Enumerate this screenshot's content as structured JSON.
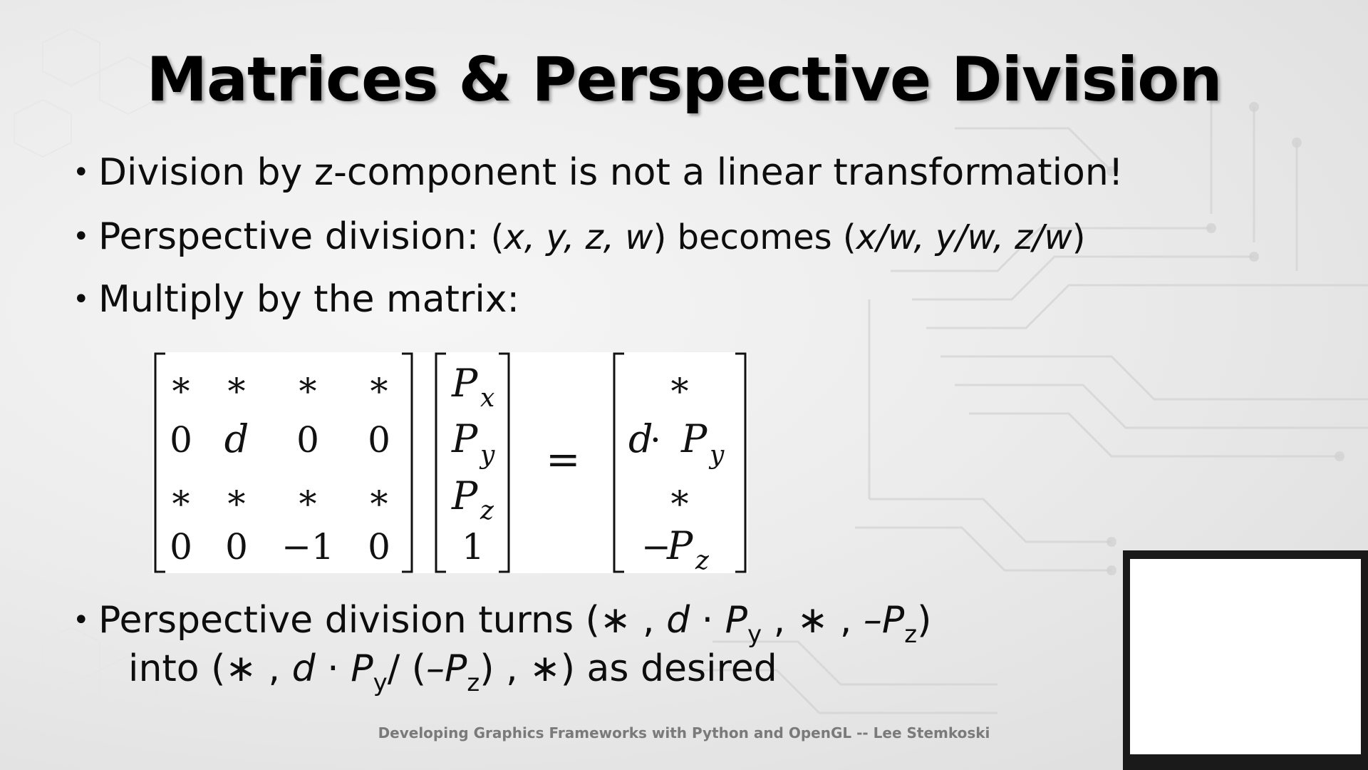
{
  "slide": {
    "title": "Matrices & Perspective Division",
    "bullets": {
      "b1": "Division by z-component is not a linear transformation!",
      "b2_prefix": "Perspective division: ",
      "b2_open": "(",
      "b2_vec": "x, y, z, w",
      "b2_mid": ") becomes (",
      "b2_res": "x/w, y/w, z/w",
      "b2_close": ")",
      "b3": "Multiply by the matrix:",
      "b4_prefix": "Perspective division turns (",
      "b4_star1": "∗ ,  ",
      "b4_d": "d",
      "b4_dot": " · ",
      "b4_P": "P",
      "b4_sub_y": "y",
      "b4_mid": " , ∗ , ",
      "b4_negP": "–P",
      "b4_sub_z": "z",
      "b4_close": ")",
      "b5_prefix": "into (∗ , ",
      "b5_d": "d",
      "b5_dot": " · ",
      "b5_P": "P",
      "b5_sub_y": "y",
      "b5_div": "/ (",
      "b5_negP": "–P",
      "b5_sub_z": "z",
      "b5_suffix": ") , ∗) as desired"
    },
    "bullet_glyph": "•",
    "matrix": {
      "rows": [
        [
          "∗",
          "∗",
          "∗",
          "∗"
        ],
        [
          "0",
          "d",
          "0",
          "0"
        ],
        [
          "∗",
          "∗",
          "∗",
          "∗"
        ],
        [
          "0",
          "0",
          "−1",
          "0"
        ]
      ],
      "vector": [
        {
          "base": "P",
          "sub": "x"
        },
        {
          "base": "P",
          "sub": "y"
        },
        {
          "base": "P",
          "sub": "z"
        },
        {
          "base": "1",
          "sub": ""
        }
      ],
      "equals": "=",
      "result": {
        "r1": "∗",
        "r2_d": "d",
        "r2_dot": " · ",
        "r2_P": "P",
        "r2_sub": "y",
        "r3": "∗",
        "r4_neg": "−",
        "r4_P": "P",
        "r4_sub": "z"
      }
    },
    "footer": "Developing Graphics Frameworks with Python and OpenGL -- Lee Stemkoski"
  }
}
